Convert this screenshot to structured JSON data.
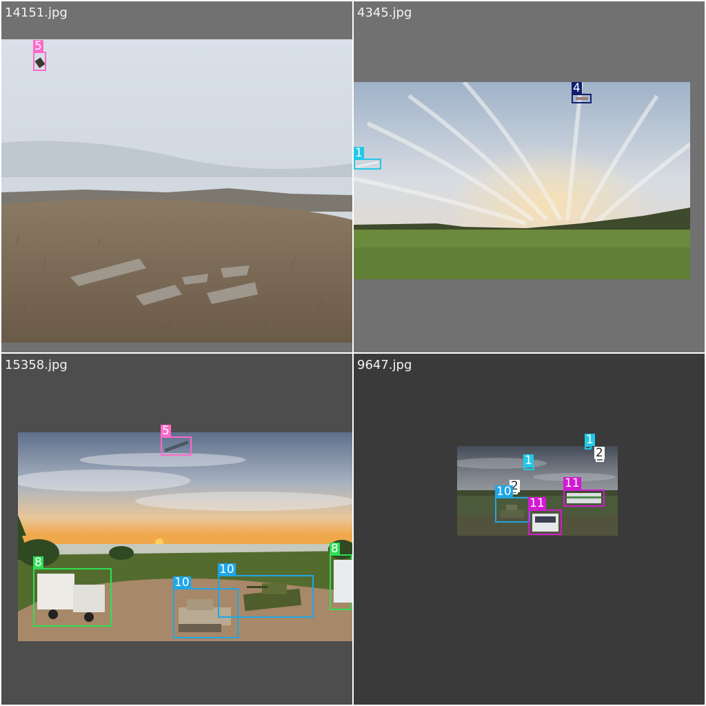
{
  "tiles": [
    {
      "filename": "14151.jpg",
      "scene": "hilltop-grassland-under-overcast-sky",
      "boxes": [
        {
          "label": "5",
          "object": "aircraft",
          "color": "#ff69c8"
        }
      ]
    },
    {
      "filename": "4345.jpg",
      "scene": "green-field-under-streaky-sunset-clouds",
      "boxes": [
        {
          "label": "4",
          "object": "aircraft",
          "color": "#0f1f6e"
        },
        {
          "label": "1",
          "object": "aircraft",
          "color": "#22c8e6"
        }
      ]
    },
    {
      "filename": "15358.jpg",
      "scene": "sunset-lakeshore-with-vehicles",
      "boxes": [
        {
          "label": "5",
          "object": "aircraft",
          "color": "#ff69c8"
        },
        {
          "label": "8",
          "object": "box-truck",
          "color": "#2ee055"
        },
        {
          "label": "8",
          "object": "truck-cab",
          "color": "#2ee055"
        },
        {
          "label": "10",
          "object": "tank",
          "color": "#1ea6e8"
        },
        {
          "label": "10",
          "object": "tank",
          "color": "#1ea6e8"
        }
      ]
    },
    {
      "filename": "9647.jpg",
      "scene": "dusk-field-with-bus-and-tank",
      "boxes": [
        {
          "label": "1",
          "object": "aircraft",
          "color": "#22c8e6"
        },
        {
          "label": "2",
          "object": "aircraft",
          "color": "#ffffff"
        },
        {
          "label": "1",
          "object": "aircraft",
          "color": "#22c8e6"
        },
        {
          "label": "2",
          "object": "aircraft",
          "color": "#ffffff"
        },
        {
          "label": "11",
          "object": "bus",
          "color": "#d21ad2"
        },
        {
          "label": "10",
          "object": "tank",
          "color": "#1ea6e8"
        },
        {
          "label": "11",
          "object": "bus",
          "color": "#d21ad2"
        }
      ]
    }
  ]
}
